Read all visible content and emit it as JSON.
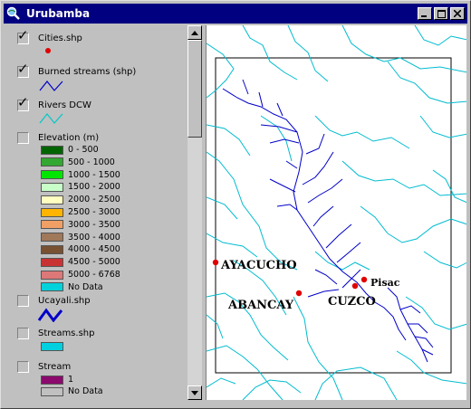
{
  "window": {
    "title": "Urubamba",
    "app_icon": "magnifier-globe-icon",
    "controls": [
      "minimize",
      "maximize",
      "close"
    ]
  },
  "toc": {
    "layers": [
      {
        "id": "cities",
        "name": "Cities.shp",
        "checked": true,
        "symbol": "red-point",
        "color": "#e00000"
      },
      {
        "id": "burned",
        "name": "Burned streams (shp)",
        "checked": true,
        "symbol": "line",
        "color": "#0000c8"
      },
      {
        "id": "rivers",
        "name": "Rivers DCW",
        "checked": true,
        "symbol": "line",
        "color": "#00c8c8"
      },
      {
        "id": "elevation",
        "name": "Elevation (m)",
        "checked": false
      },
      {
        "id": "ucayali",
        "name": "Ucayali.shp",
        "checked": false,
        "symbol": "line-thick",
        "color": "#0000c8"
      },
      {
        "id": "streams",
        "name": "Streams.shp",
        "checked": false,
        "symbol": "box",
        "color": "#00d0e0"
      },
      {
        "id": "stream",
        "name": "Stream",
        "checked": false
      }
    ],
    "elevation_classes": [
      {
        "label": "0 - 500",
        "color": "#006400"
      },
      {
        "label": "500 - 1000",
        "color": "#32a832"
      },
      {
        "label": "1000 - 1500",
        "color": "#00e600"
      },
      {
        "label": "1500 - 2000",
        "color": "#c8ffc8"
      },
      {
        "label": "2000 - 2500",
        "color": "#ffffc0"
      },
      {
        "label": "2500 - 3000",
        "color": "#ffb400"
      },
      {
        "label": "3000 - 3500",
        "color": "#f0a064"
      },
      {
        "label": "3500 - 4000",
        "color": "#a0785a"
      },
      {
        "label": "4000 - 4500",
        "color": "#785032"
      },
      {
        "label": "4500 - 5000",
        "color": "#c83232"
      },
      {
        "label": "5000 - 6768",
        "color": "#dc7878"
      },
      {
        "label": "No Data",
        "color": "#00d2dc"
      }
    ],
    "stream_classes": [
      {
        "label": "1",
        "color": "#8c0a6e"
      },
      {
        "label": "No Data",
        "color": "#c0c0c0"
      }
    ]
  },
  "map": {
    "cities": [
      {
        "name": "AYACUCHO"
      },
      {
        "name": "ABANCAY"
      },
      {
        "name": "CUZCO"
      },
      {
        "name": "Pisac"
      }
    ],
    "river_color": "#00bcd0",
    "stream_color": "#0000c8",
    "city_color": "#e00000"
  }
}
